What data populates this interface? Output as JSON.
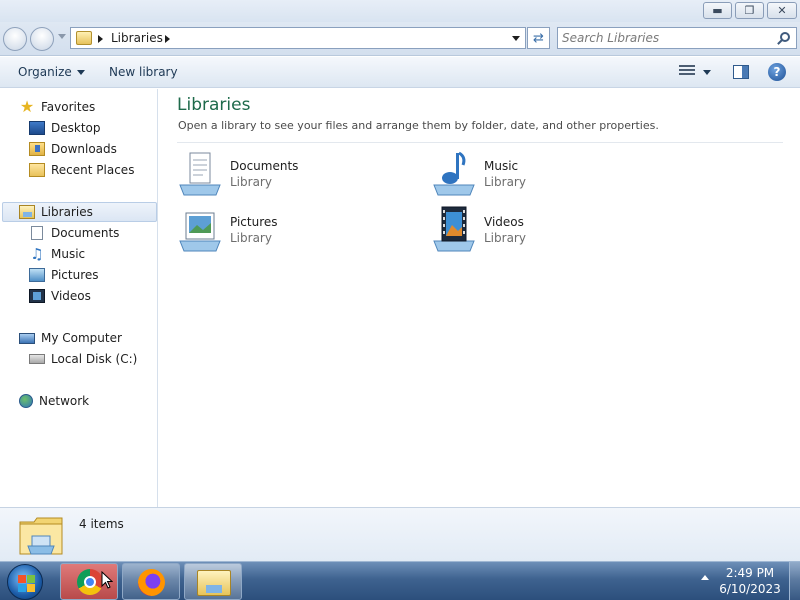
{
  "window": {
    "title": "",
    "buttons": {
      "minimize_icon": "minimize-icon",
      "maximize_icon": "restore-icon",
      "close_icon": "close-icon"
    }
  },
  "nav": {
    "address_path": [
      "Libraries"
    ],
    "search_placeholder": "Search Libraries"
  },
  "toolbar": {
    "organize_label": "Organize",
    "new_library_label": "New library"
  },
  "sidebar": {
    "favorites": {
      "label": "Favorites",
      "items": [
        {
          "label": "Desktop",
          "icon": "desktop-icon"
        },
        {
          "label": "Downloads",
          "icon": "downloads-icon"
        },
        {
          "label": "Recent Places",
          "icon": "recent-places-icon"
        }
      ]
    },
    "libraries": {
      "label": "Libraries",
      "items": [
        {
          "label": "Documents",
          "icon": "documents-icon"
        },
        {
          "label": "Music",
          "icon": "music-icon"
        },
        {
          "label": "Pictures",
          "icon": "pictures-icon"
        },
        {
          "label": "Videos",
          "icon": "videos-icon"
        }
      ]
    },
    "computer": {
      "label": "My Computer",
      "items": [
        {
          "label": "Local Disk (C:)",
          "icon": "disk-icon"
        }
      ]
    },
    "network": {
      "label": "Network"
    }
  },
  "main": {
    "title": "Libraries",
    "subtitle": "Open a library to see your files and arrange them by folder, date, and other properties.",
    "libraries": [
      {
        "name": "Documents",
        "type": "Library",
        "icon": "documents-library-icon"
      },
      {
        "name": "Music",
        "type": "Library",
        "icon": "music-library-icon"
      },
      {
        "name": "Pictures",
        "type": "Library",
        "icon": "pictures-library-icon"
      },
      {
        "name": "Videos",
        "type": "Library",
        "icon": "videos-library-icon"
      }
    ]
  },
  "details": {
    "count": "4 items"
  },
  "taskbar": {
    "apps": [
      "Chrome",
      "Firefox",
      "Windows Explorer"
    ],
    "clock_time": "2:49 PM",
    "clock_date": "6/10/2023"
  },
  "colors": {
    "title_green": "#1e6a4b",
    "taskbar": "#3e628f"
  }
}
